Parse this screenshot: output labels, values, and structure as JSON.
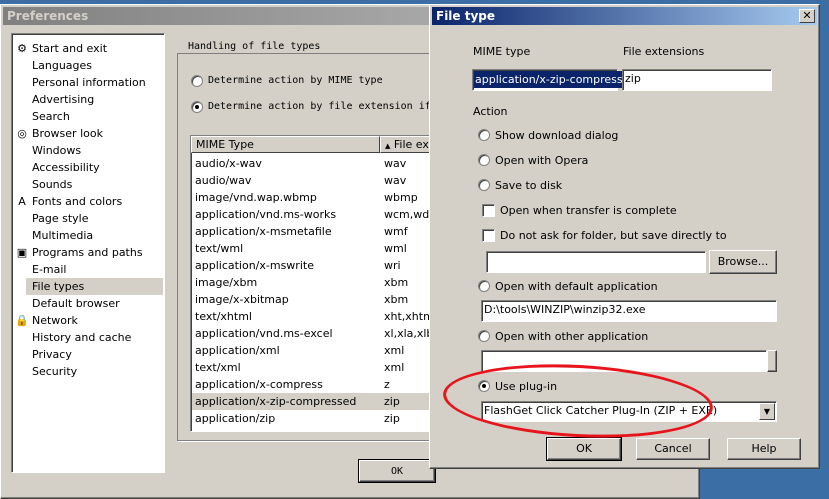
{
  "pref_window": {
    "title": "Preferences",
    "tree": [
      {
        "label": "Start and exit",
        "icon": "start-icon"
      },
      {
        "label": "Languages",
        "icon": ""
      },
      {
        "label": "Personal information",
        "icon": ""
      },
      {
        "label": "Advertising",
        "icon": ""
      },
      {
        "label": "Search",
        "icon": ""
      },
      {
        "label": "Browser look",
        "icon": "browser-look-icon"
      },
      {
        "label": "Windows",
        "icon": ""
      },
      {
        "label": "Accessibility",
        "icon": ""
      },
      {
        "label": "Sounds",
        "icon": ""
      },
      {
        "label": "Fonts and colors",
        "icon": "fonts-icon"
      },
      {
        "label": "Page style",
        "icon": ""
      },
      {
        "label": "Multimedia",
        "icon": ""
      },
      {
        "label": "Programs and paths",
        "icon": "programs-icon"
      },
      {
        "label": "E-mail",
        "icon": ""
      },
      {
        "label": "File types",
        "icon": ""
      },
      {
        "label": "Default browser",
        "icon": ""
      },
      {
        "label": "Network",
        "icon": "network-icon"
      },
      {
        "label": "History and cache",
        "icon": ""
      },
      {
        "label": "Privacy",
        "icon": ""
      },
      {
        "label": "Security",
        "icon": ""
      }
    ],
    "selected_item": "File types",
    "group_title": "Handling of file types",
    "radio_mime": "Determine action by MIME type",
    "radio_ext": "Determine action by file extension if",
    "columns": [
      "MIME Type",
      "File exte"
    ],
    "rows": [
      [
        "audio/x-wav",
        "wav"
      ],
      [
        "audio/wav",
        "wav"
      ],
      [
        "image/vnd.wap.wbmp",
        "wbmp"
      ],
      [
        "application/vnd.ms-works",
        "wcm,wdb,"
      ],
      [
        "application/x-msmetafile",
        "wmf"
      ],
      [
        "text/wml",
        "wml"
      ],
      [
        "application/x-mswrite",
        "wri"
      ],
      [
        "image/xbm",
        "xbm"
      ],
      [
        "image/x-xbitmap",
        "xbm"
      ],
      [
        "text/xhtml",
        "xht,xhtm,"
      ],
      [
        "application/vnd.ms-excel",
        "xl,xla,xlb,"
      ],
      [
        "application/xml",
        "xml"
      ],
      [
        "text/xml",
        "xml"
      ],
      [
        "application/x-compress",
        "z"
      ],
      [
        "application/x-zip-compressed",
        "zip"
      ],
      [
        "application/zip",
        "zip"
      ]
    ],
    "ok_label": "OK"
  },
  "filetype_dialog": {
    "title": "File type",
    "close_glyph": "✕",
    "mime_label": "MIME type",
    "ext_label": "File extensions",
    "mime_value": "application/x-zip-compressed",
    "ext_value": "zip",
    "action_label": "Action",
    "opt_download": "Show download dialog",
    "opt_opera": "Open with Opera",
    "opt_save": "Save to disk",
    "chk_open_complete": "Open when transfer is complete",
    "chk_no_ask": "Do not ask for folder, but save directly to",
    "save_path": "",
    "browse_label": "Browse...",
    "opt_default_app": "Open with default application",
    "default_app_path": "D:\\tools\\WINZIP\\winzip32.exe",
    "opt_other_app": "Open with other application",
    "other_app_path": "",
    "opt_plugin": "Use plug-in",
    "plugin_value": "FlashGet Click Catcher Plug-In (ZIP + EXE)",
    "ok_label": "OK",
    "cancel_label": "Cancel",
    "help_label": "Help",
    "annotation_color": "#e8141c"
  }
}
